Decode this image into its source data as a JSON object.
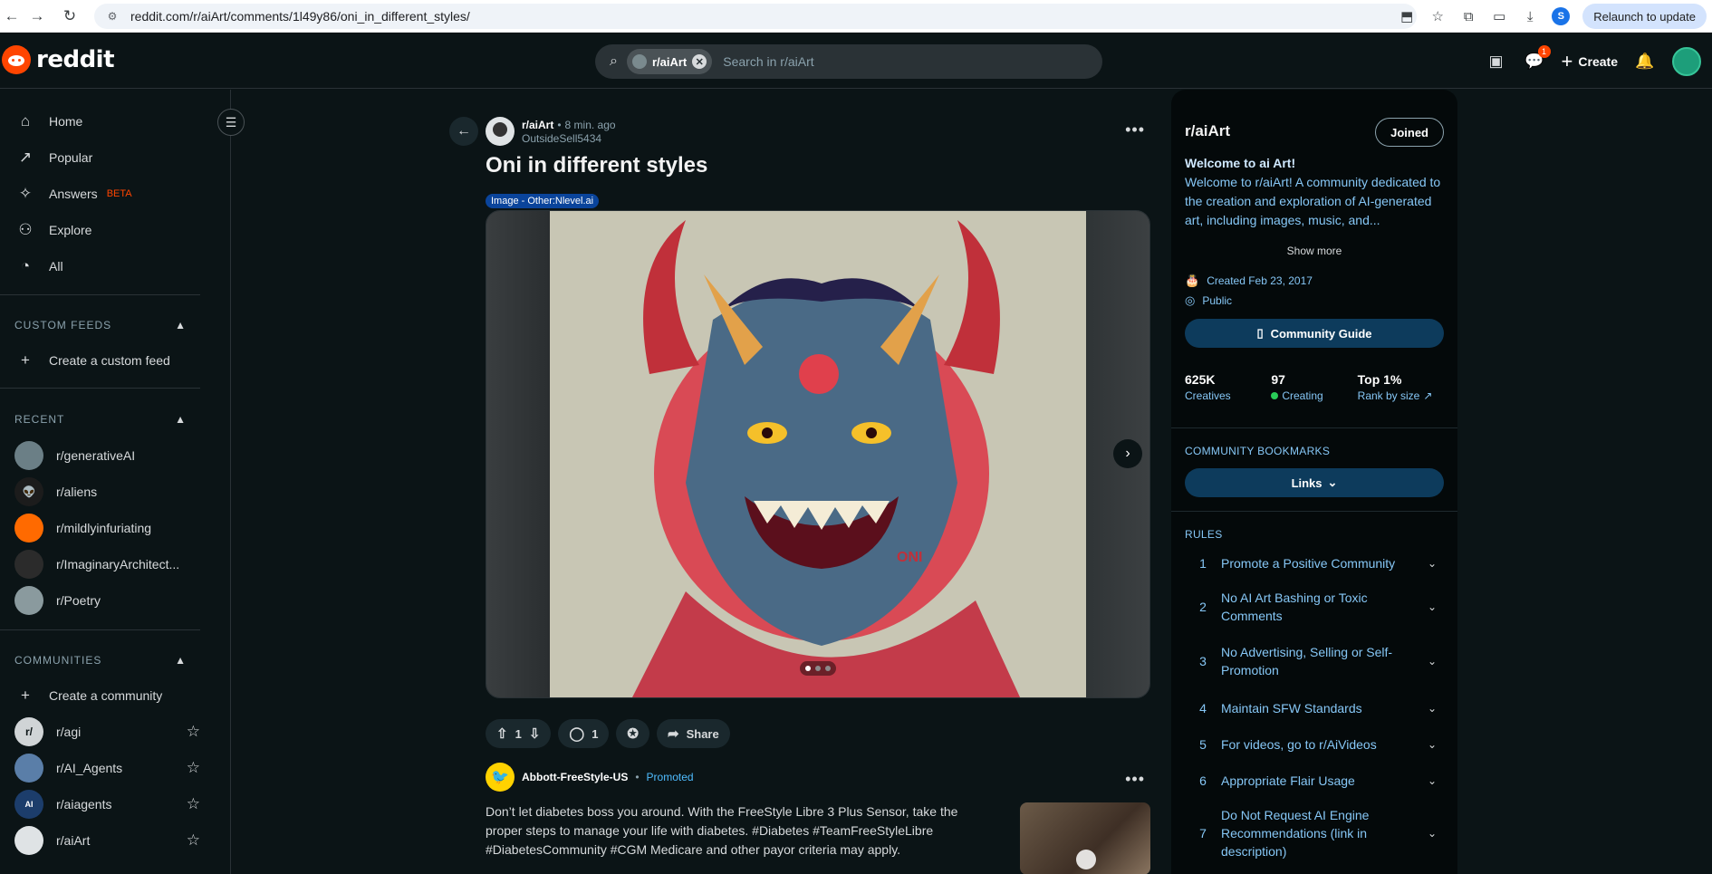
{
  "browser": {
    "url": "reddit.com/r/aiArt/comments/1l49y86/oni_in_different_styles/",
    "relaunch_label": "Relaunch to update",
    "profile_initial": "S"
  },
  "header": {
    "logo_text": "reddit",
    "search_chip": "r/aiArt",
    "search_placeholder": "Search in r/aiArt",
    "chat_badge": "1",
    "create_label": "Create"
  },
  "sidebar": {
    "nav": [
      {
        "label": "Home",
        "icon": "home-icon"
      },
      {
        "label": "Popular",
        "icon": "popular-icon"
      },
      {
        "label": "Answers",
        "icon": "answers-icon",
        "badge": "BETA"
      },
      {
        "label": "Explore",
        "icon": "explore-icon"
      },
      {
        "label": "All",
        "icon": "all-icon"
      }
    ],
    "custom_feeds_header": "CUSTOM FEEDS",
    "create_feed_label": "Create a custom feed",
    "recent_header": "RECENT",
    "recent": [
      {
        "label": "r/generativeAI",
        "color": "#6b7f86"
      },
      {
        "label": "r/aliens",
        "color": "#1c1c1c"
      },
      {
        "label": "r/mildlyinfuriating",
        "color": "#ff6a00"
      },
      {
        "label": "r/ImaginaryArchitect...",
        "color": "#2b2b2b"
      },
      {
        "label": "r/Poetry",
        "color": "#8a9a9e"
      }
    ],
    "communities_header": "COMMUNITIES",
    "create_community_label": "Create a community",
    "communities": [
      {
        "label": "r/agi",
        "color": "#d0d4d6",
        "glyph": "r/"
      },
      {
        "label": "r/AI_Agents",
        "color": "#5a7ea8",
        "glyph": ""
      },
      {
        "label": "r/aiagents",
        "color": "#1c3d6b",
        "glyph": "AI"
      },
      {
        "label": "r/aiArt",
        "color": "#dfe3e5",
        "glyph": ""
      }
    ]
  },
  "post": {
    "subreddit": "r/aiArt",
    "dot": "•",
    "time": "8 min. ago",
    "author": "OutsideSell5434",
    "title": "Oni in different styles",
    "flair": "Image - Other:Nlevel.ai",
    "image_alt": "Oni demon mask illustration",
    "watermark": "ONI",
    "carousel_pages": 3,
    "carousel_current": 1,
    "votes": "1",
    "comments": "1",
    "share_label": "Share"
  },
  "promo": {
    "advertiser": "Abbott-FreeStyle-US",
    "dot": "•",
    "tag": "Promoted",
    "text": "Don’t let diabetes boss you around. With the FreeStyle Libre 3 Plus Sensor, take the proper steps to manage your life with diabetes. #Diabetes #TeamFreeStyleLibre #DiabetesCommunity #CGM Medicare and other payor criteria may apply."
  },
  "community": {
    "name": "r/aiArt",
    "joined_label": "Joined",
    "welcome_title": "Welcome to ai Art!",
    "welcome_text": "Welcome to r/aiArt! A community dedicated to the creation and exploration of AI-generated art, including images, music, and...",
    "show_more": "Show more",
    "created": "Created Feb 23, 2017",
    "visibility": "Public",
    "guide_label": "Community Guide",
    "stats": [
      {
        "value": "625K",
        "label": "Creatives"
      },
      {
        "value": "97",
        "label": "Creating"
      },
      {
        "value": "Top 1%",
        "label": "Rank by size"
      }
    ],
    "bookmarks_header": "COMMUNITY BOOKMARKS",
    "links_label": "Links",
    "rules_header": "RULES",
    "rules": [
      {
        "num": "1",
        "text": "Promote a Positive Community"
      },
      {
        "num": "2",
        "text": "No AI Art Bashing or Toxic Comments"
      },
      {
        "num": "3",
        "text": "No Advertising, Selling or Self-Promotion"
      },
      {
        "num": "4",
        "text": "Maintain SFW Standards"
      },
      {
        "num": "5",
        "text": "For videos, go to r/AiVideos"
      },
      {
        "num": "6",
        "text": "Appropriate Flair Usage"
      },
      {
        "num": "7",
        "text": "Do Not Request AI Engine Recommendations (link in description)"
      }
    ]
  },
  "colors": {
    "accent_orange": "#ff4500",
    "link_blue": "#86c7f6",
    "flair_blue": "#0a449b",
    "online_green": "#29cc58"
  }
}
